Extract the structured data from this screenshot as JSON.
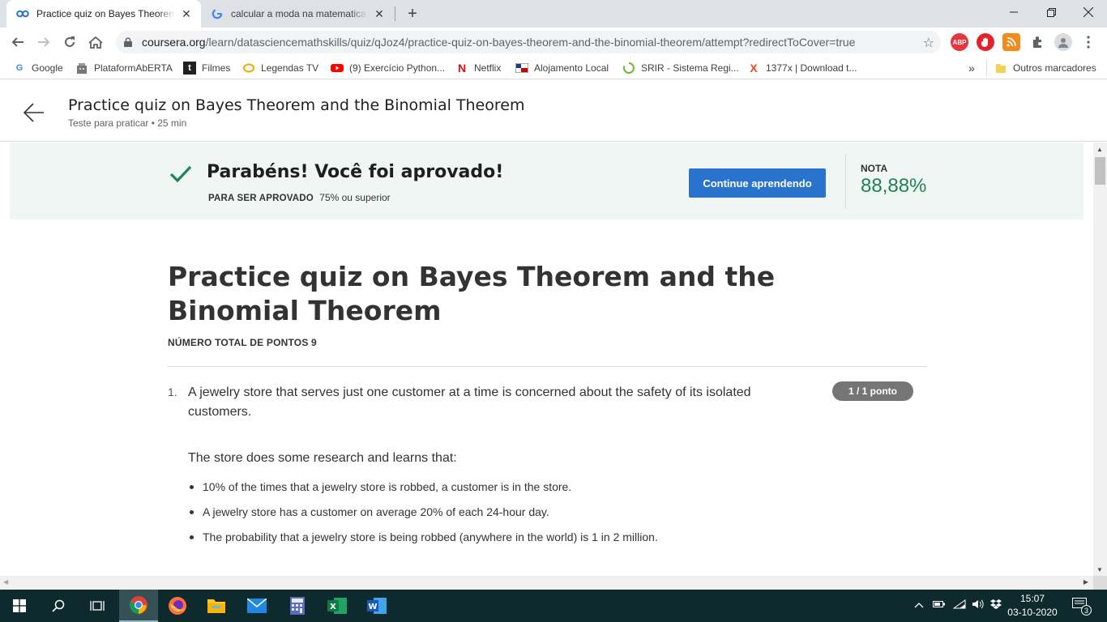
{
  "tabs": [
    {
      "title": "Practice quiz on Bayes Theorem and the Binomial Theorem",
      "favicon": "coursera-icon",
      "active": true
    },
    {
      "title": "calcular a moda na matematica - Pesquisa Google",
      "favicon": "google-icon",
      "active": false
    }
  ],
  "address_bar": {
    "host": "coursera.org",
    "path": "/learn/datasciencemathskills/quiz/qJoz4/practice-quiz-on-bayes-theorem-and-the-binomial-theorem/attempt?redirectToCover=true"
  },
  "extensions": [
    "ABP",
    "adblocker-icon",
    "rss-icon",
    "extensions-icon",
    "profile-icon"
  ],
  "bookmarks": [
    {
      "label": "Google",
      "icon": "google-icon"
    },
    {
      "label": "PlataformAbERTA",
      "icon": "building-icon"
    },
    {
      "label": "Filmes",
      "icon": "tumblr-icon"
    },
    {
      "label": "Legendas TV",
      "icon": "ring-icon"
    },
    {
      "label": "(9) Exercício Python...",
      "icon": "youtube-icon"
    },
    {
      "label": "Netflix",
      "icon": "netflix-icon"
    },
    {
      "label": "Alojamento Local",
      "icon": "flag-icon"
    },
    {
      "label": "SRIR - Sistema Regi...",
      "icon": "swirl-icon"
    },
    {
      "label": "1377x | Download t...",
      "icon": "x-icon"
    }
  ],
  "bookmarks_overflow": "»",
  "other_bookmarks": "Outros marcadores",
  "header": {
    "title": "Practice quiz on Bayes Theorem and the Binomial Theorem",
    "subtitle": "Teste para praticar • 25 min"
  },
  "result": {
    "message": "Parabéns! Você foi aprovado!",
    "pass_label": "PARA SER APROVADO",
    "pass_value": "75% ou superior",
    "continue_label": "Continue aprendendo",
    "grade_label": "NOTA",
    "grade_value": "88,88%"
  },
  "quiz": {
    "title": "Practice quiz on Bayes Theorem and the Binomial Theorem",
    "total_points": "NÚMERO TOTAL DE PONTOS 9",
    "question_number": "1.",
    "question_text": "A jewelry store that serves just one customer at a time is concerned about the safety of its isolated customers.",
    "points": "1 / 1 ponto",
    "lead": "The store does some research and learns that:",
    "facts": [
      "10% of the times that a jewelry store is robbed, a customer is in the store.",
      "A jewelry store has a customer on average 20% of each 24-hour day.",
      "The probability that a jewelry store is being robbed (anywhere in the world) is 1 in 2 million."
    ]
  },
  "taskbar": {
    "apps": [
      "windows-start-icon",
      "search-icon",
      "task-view-icon",
      "chrome-icon",
      "firefox-icon",
      "file-explorer-icon",
      "mail-icon",
      "calculator-icon",
      "excel-icon",
      "word-icon"
    ],
    "time": "15:07",
    "date": "03-10-2020",
    "notifications": "3"
  },
  "colors": {
    "accent_blue": "#2a73cc",
    "success_green": "#1f8354",
    "banner_bg": "#f0f6f4",
    "taskbar_bg": "#0f2a2d"
  }
}
